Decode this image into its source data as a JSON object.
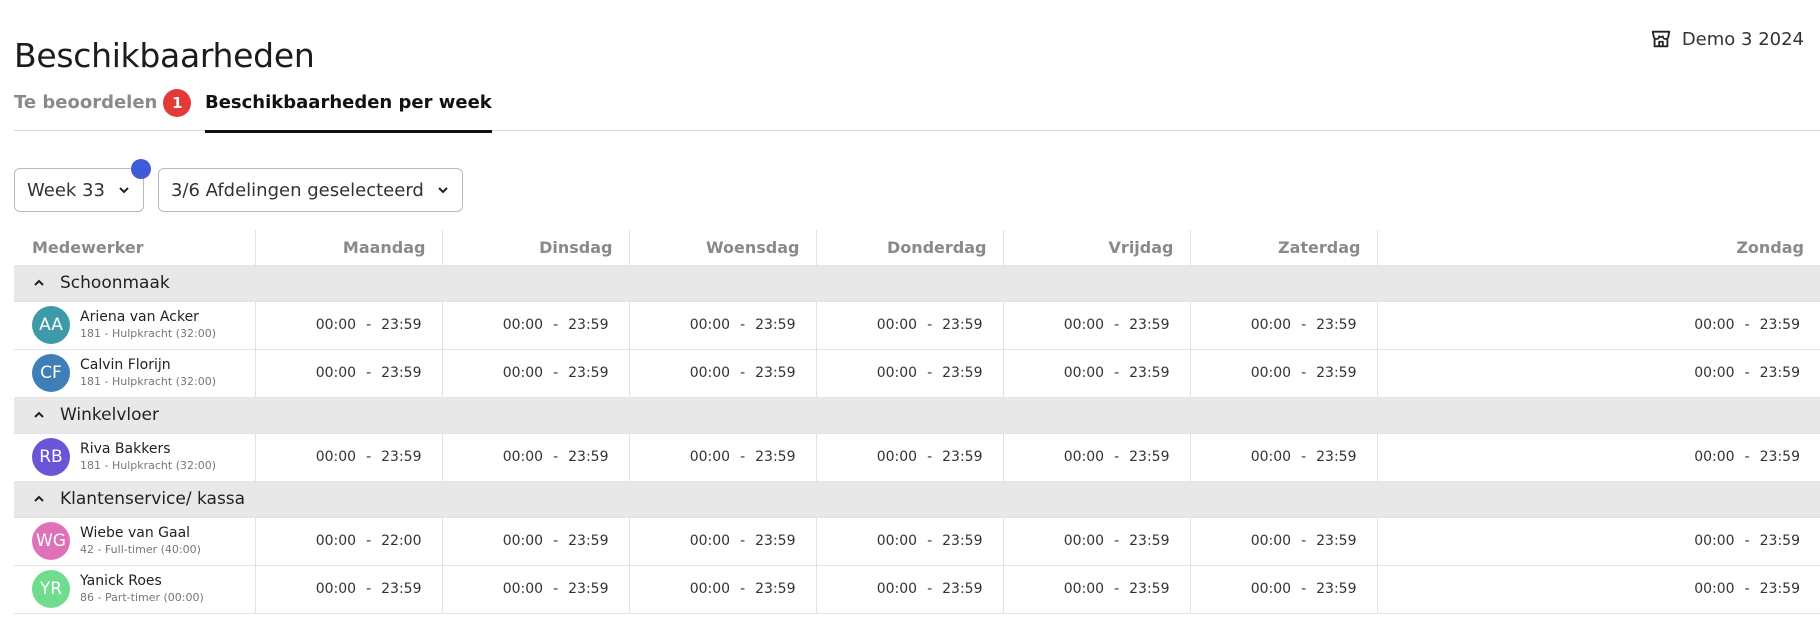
{
  "page": {
    "title": "Beschikbaarheden"
  },
  "store": {
    "label": "Demo 3 2024",
    "icon": "store-icon"
  },
  "tabs": [
    {
      "label": "Te beoordelen",
      "badge": "1",
      "active": false
    },
    {
      "label": "Beschikbaarheden per week",
      "active": true
    }
  ],
  "filters": {
    "week": {
      "value": "Week 33"
    },
    "departments": {
      "value": "3/6 Afdelingen geselecteerd"
    }
  },
  "table": {
    "columns": [
      "Medewerker",
      "Maandag",
      "Dinsdag",
      "Woensdag",
      "Donderdag",
      "Vrijdag",
      "Zaterdag",
      "Zondag"
    ],
    "groups": [
      {
        "name": "Schoonmaak",
        "employees": [
          {
            "initials": "AA",
            "name": "Ariena van Acker",
            "sub": "181 - Hulpkracht (32:00)",
            "color": "#3d9aa8",
            "days": [
              [
                "00:00",
                "23:59"
              ],
              [
                "00:00",
                "23:59"
              ],
              [
                "00:00",
                "23:59"
              ],
              [
                "00:00",
                "23:59"
              ],
              [
                "00:00",
                "23:59"
              ],
              [
                "00:00",
                "23:59"
              ],
              [
                "00:00",
                "23:59"
              ]
            ]
          },
          {
            "initials": "CF",
            "name": "Calvin Florijn",
            "sub": "181 - Hulpkracht (32:00)",
            "color": "#3f7fb8",
            "days": [
              [
                "00:00",
                "23:59"
              ],
              [
                "00:00",
                "23:59"
              ],
              [
                "00:00",
                "23:59"
              ],
              [
                "00:00",
                "23:59"
              ],
              [
                "00:00",
                "23:59"
              ],
              [
                "00:00",
                "23:59"
              ],
              [
                "00:00",
                "23:59"
              ]
            ]
          }
        ]
      },
      {
        "name": "Winkelvloer",
        "employees": [
          {
            "initials": "RB",
            "name": "Riva Bakkers",
            "sub": "181 - Hulpkracht (32:00)",
            "color": "#6a55d8",
            "days": [
              [
                "00:00",
                "23:59"
              ],
              [
                "00:00",
                "23:59"
              ],
              [
                "00:00",
                "23:59"
              ],
              [
                "00:00",
                "23:59"
              ],
              [
                "00:00",
                "23:59"
              ],
              [
                "00:00",
                "23:59"
              ],
              [
                "00:00",
                "23:59"
              ]
            ]
          }
        ]
      },
      {
        "name": "Klantenservice/ kassa",
        "employees": [
          {
            "initials": "WG",
            "name": "Wiebe van Gaal",
            "sub": "42 - Full-timer (40:00)",
            "color": "#e070b8",
            "days": [
              [
                "00:00",
                "22:00"
              ],
              [
                "00:00",
                "23:59"
              ],
              [
                "00:00",
                "23:59"
              ],
              [
                "00:00",
                "23:59"
              ],
              [
                "00:00",
                "23:59"
              ],
              [
                "00:00",
                "23:59"
              ],
              [
                "00:00",
                "23:59"
              ]
            ]
          },
          {
            "initials": "YR",
            "name": "Yanick Roes",
            "sub": "86 - Part-timer (00:00)",
            "color": "#6fdc8e",
            "days": [
              [
                "00:00",
                "23:59"
              ],
              [
                "00:00",
                "23:59"
              ],
              [
                "00:00",
                "23:59"
              ],
              [
                "00:00",
                "23:59"
              ],
              [
                "00:00",
                "23:59"
              ],
              [
                "00:00",
                "23:59"
              ],
              [
                "00:00",
                "23:59"
              ]
            ]
          }
        ]
      }
    ]
  }
}
